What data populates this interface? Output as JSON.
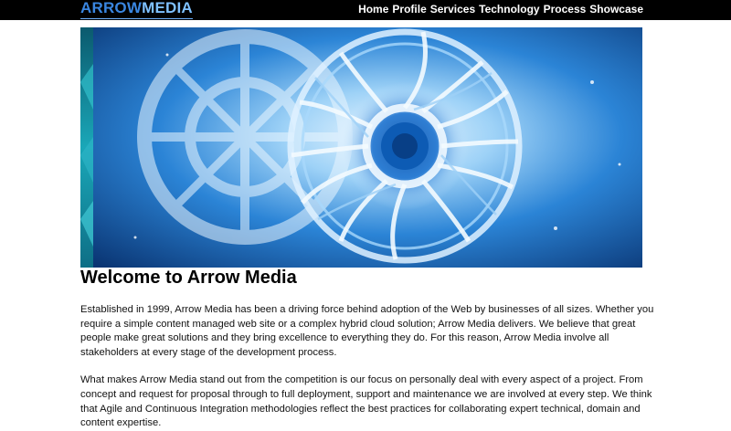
{
  "header": {
    "logo": {
      "part1": "ARROW",
      "part2": "MEDIA"
    },
    "nav": [
      "Home",
      "Profile",
      "Services",
      "Technology",
      "Process",
      "Showcase"
    ]
  },
  "hero": {
    "image": "abstract-crystal-wheel"
  },
  "main": {
    "title": "Welcome to Arrow Media",
    "paragraphs": [
      "Established in 1999, Arrow Media has been a driving force behind adoption of the Web by businesses of all sizes. Whether you require a simple content managed web site or a complex hybrid cloud solution; Arrow Media delivers. We believe that great people make great solutions and they bring excellence to everything they do. For this reason, Arrow Media involve all stakeholders at every stage of the development process.",
      "What makes Arrow Media stand out from the competition is our focus on personally deal with every aspect of a project. From concept and request for proposal through to full deployment, support and maintenance we are involved at every step. We think that Agile and Continuous Integration methodologies reflect the best practices for collaborating expert technical, domain and content expertise."
    ]
  },
  "colors": {
    "topbar": "#000000",
    "logo": "#3a86e0",
    "nav_text": "#ffffff",
    "hero_base": "#0b3d80"
  }
}
